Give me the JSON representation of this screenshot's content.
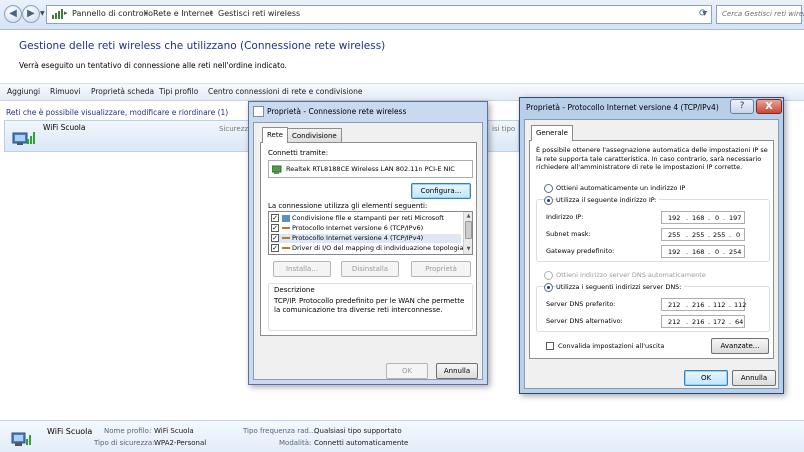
{
  "address_bar": {
    "crumbs": [
      "Pannello di controllo",
      "Rete e Internet",
      "Gestisci reti wireless"
    ],
    "search_placeholder": "Cerca Gestisci reti wireless"
  },
  "page": {
    "title": "Gestione delle reti wireless che utilizzano (Connessione rete wireless)",
    "subtitle": "Verrà eseguito un tentativo di connessione alle reti nell'ordine indicato."
  },
  "toolbar": {
    "items": [
      "Aggiungi",
      "Rimuovi",
      "Proprietà scheda",
      "Tipi profilo",
      "Centro connessioni di rete e condivisione"
    ]
  },
  "network_list": {
    "header": "Reti che è possibile visualizzare, modificare e riordinare (1)",
    "row": {
      "name": "WiFi Scuola",
      "col_security": "Sicurezz",
      "col_type": "isi tipo"
    }
  },
  "details": {
    "name": "WiFi Scuola",
    "profile_label": "Nome profilo:",
    "profile_value": "WiFi Scuola",
    "security_label": "Tipo di sicurezza:",
    "security_value": "WPA2-Personal",
    "radio_label": "Tipo frequenza rad...",
    "radio_value": "Qualsiasi tipo supportato",
    "mode_label": "Modalità:",
    "mode_value": "Connetti automaticamente"
  },
  "props_dialog": {
    "title": "Proprietà - Connessione rete wireless",
    "tabs": [
      "Rete",
      "Condivisione"
    ],
    "connect_using_label": "Connetti tramite:",
    "adapter": "Realtek RTL8188CE Wireless LAN 802.11n PCI-E NIC",
    "configure_btn": "Configura...",
    "items_label": "La connessione utilizza gli elementi seguenti:",
    "items": [
      "Condivisione file e stampanti per reti Microsoft",
      "Protocollo Internet versione 6 (TCP/IPv6)",
      "Protocollo Internet versione 4 (TCP/IPv4)",
      "Driver di I/O del mapping di individuazione topologia liv"
    ],
    "install_btn": "Installa...",
    "uninstall_btn": "Disinstalla",
    "properties_btn": "Proprietà",
    "desc_title": "Descrizione",
    "desc_text": "TCP/IP. Protocollo predefinito per le WAN che permette la comunicazione tra diverse reti interconnesse.",
    "ok_btn": "OK",
    "cancel_btn": "Annulla"
  },
  "ipv4_dialog": {
    "title": "Proprietà - Protocollo Internet versione 4 (TCP/IPv4)",
    "help": "?",
    "close": "X",
    "tab": "Generale",
    "info": "È possibile ottenere l'assegnazione automatica delle impostazioni IP se la rete supporta tale caratteristica. In caso contrario, sarà necessario richiedere all'amministratore di rete le impostazioni IP corrette.",
    "auto_ip": "Ottieni automaticamente un indirizzo IP",
    "manual_ip": "Utilizza il seguente indirizzo IP:",
    "ip_label": "Indirizzo IP:",
    "ip": [
      "192",
      "168",
      "0",
      "197"
    ],
    "mask_label": "Subnet mask:",
    "mask": [
      "255",
      "255",
      "255",
      "0"
    ],
    "gw_label": "Gateway predefinito:",
    "gw": [
      "192",
      "168",
      "0",
      "254"
    ],
    "auto_dns": "Ottieni indirizzo server DNS automaticamente",
    "manual_dns": "Utilizza i seguenti indirizzi server DNS:",
    "dns1_label": "Server DNS preferito:",
    "dns1": [
      "212",
      "216",
      "112",
      "112"
    ],
    "dns2_label": "Server DNS alternativo:",
    "dns2": [
      "212",
      "216",
      "172",
      "64"
    ],
    "validate": "Convalida impostazioni all'uscita",
    "advanced_btn": "Avanzate...",
    "ok_btn": "OK",
    "cancel_btn": "Annulla"
  }
}
